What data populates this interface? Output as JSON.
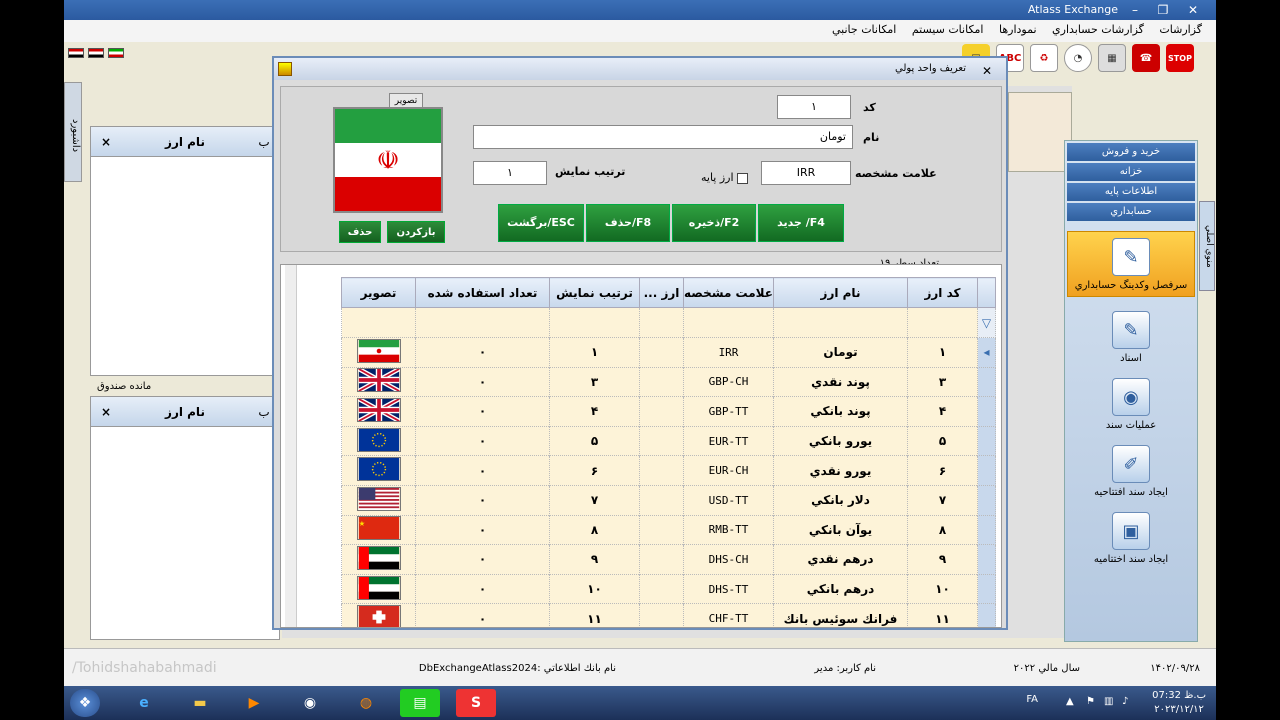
{
  "app": {
    "title": "Atlass Exchange",
    "minimize": "–",
    "restore": "❐",
    "close": "✕",
    "menu": [
      "گزارشات",
      "گزارشات حسابداري",
      "نمودارها",
      "امكانات سيستم",
      "امكانات جانبي"
    ]
  },
  "toolbar": {
    "stop_label": "STOP",
    "abc_label": "ABC"
  },
  "left": {
    "vtab_label": "داشبورد",
    "col_name": "نام ارز",
    "col_x": "×",
    "col_b": "ب",
    "box_label": "مانده صندوق"
  },
  "sidebar": {
    "vtab_label": "منوي اصلي",
    "tabs": [
      "خريد و فروش",
      "خزانه",
      "اطلاعات پايه",
      "حسابداري"
    ],
    "big_label": "سرفصل وكدينگ حسابداري",
    "items": [
      {
        "label": "اسناد",
        "icon": "document-icon"
      },
      {
        "label": "عمليات سند",
        "icon": "camera-icon"
      },
      {
        "label": "ايجاد سند افتتاحيه",
        "icon": "edit-icon"
      },
      {
        "label": "ايجاد سند اختتاميه",
        "icon": "window-icon"
      }
    ]
  },
  "dialog": {
    "title": "تعريف واحد پولي",
    "close": "✕",
    "image_tab": "تصوير",
    "code_label": "كد",
    "code_value": "١",
    "name_label": "نام",
    "name_value": "تومان",
    "symbol_label": "علامت مشخصه",
    "symbol_value": "IRR",
    "base_label": "ارز پايه",
    "order_label": "ترتيب نمايش",
    "order_value": "١",
    "reload_btn": "بازكردن",
    "delete_img_btn": "حذف",
    "new_btn": "جديد /F4",
    "save_btn": "ذخيره/F2",
    "delete_btn": "حذف/F8",
    "back_btn": "برگشت/ESC",
    "count_label": "تعداد سطر ١٩"
  },
  "grid": {
    "columns": [
      "كد ارز",
      "نام ارز",
      "علامت مشخصه",
      "ارز ...",
      "ترتيب نمايش",
      "تعداد استفاده شده",
      "تصوير"
    ],
    "rows": [
      {
        "code": "١",
        "name": "تومان",
        "symbol": "IRR",
        "base": "",
        "order": "١",
        "used": "٠",
        "flag": "ir"
      },
      {
        "code": "٣",
        "name": "پوند نقدي",
        "symbol": "GBP-CH",
        "base": "",
        "order": "٣",
        "used": "٠",
        "flag": "uk"
      },
      {
        "code": "۴",
        "name": "پوند بانكي",
        "symbol": "GBP-TT",
        "base": "",
        "order": "۴",
        "used": "٠",
        "flag": "uk"
      },
      {
        "code": "۵",
        "name": "يورو بانكي",
        "symbol": "EUR-TT",
        "base": "",
        "order": "۵",
        "used": "٠",
        "flag": "eu"
      },
      {
        "code": "۶",
        "name": "يورو نقدي",
        "symbol": "EUR-CH",
        "base": "",
        "order": "۶",
        "used": "٠",
        "flag": "eu"
      },
      {
        "code": "٧",
        "name": "دلار بانكي",
        "symbol": "USD-TT",
        "base": "",
        "order": "٧",
        "used": "٠",
        "flag": "us"
      },
      {
        "code": "٨",
        "name": "يوآن بانكي",
        "symbol": "RMB-TT",
        "base": "",
        "order": "٨",
        "used": "٠",
        "flag": "cn"
      },
      {
        "code": "٩",
        "name": "درهم نقدي",
        "symbol": "DHS-CH",
        "base": "",
        "order": "٩",
        "used": "٠",
        "flag": "ae"
      },
      {
        "code": "١٠",
        "name": "درهم بانكي",
        "symbol": "DHS-TT",
        "base": "",
        "order": "١٠",
        "used": "٠",
        "flag": "ae"
      },
      {
        "code": "١١",
        "name": "فرانك سوئيس بانك",
        "symbol": "CHF-TT",
        "base": "",
        "order": "١١",
        "used": "٠",
        "flag": "ch"
      }
    ]
  },
  "status": {
    "db": "نام بانك اطلاعاتي :DbExchangeAtlass2024",
    "user": "نام كاربر: مدير",
    "year": "سال مالي ٢٠٢٢",
    "date": "١۴٠٢/٠٩/٢٨"
  },
  "watermark": "/Tohidshahabahmadi",
  "taskbar": {
    "lang": "FA",
    "time": "07:32 ب.ظ",
    "date": "٢٠٢٣/١٢/١٢"
  },
  "colors": {
    "green_button": "#1e7a2c",
    "grid_row": "#fdf3d8",
    "header_blue": "#2b5aa0"
  }
}
